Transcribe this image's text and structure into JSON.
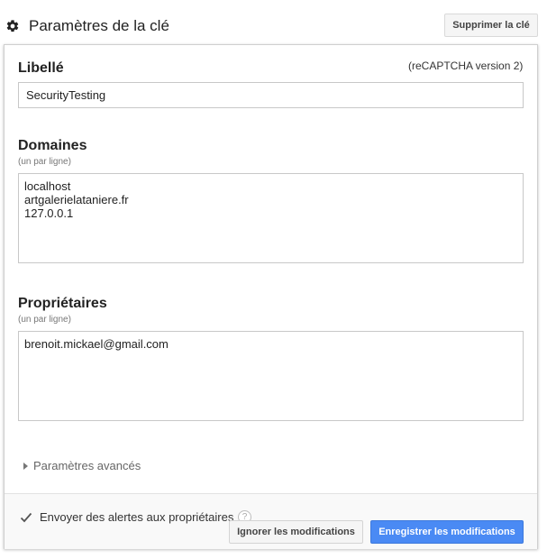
{
  "header": {
    "title": "Paramètres de la clé",
    "icon": "gear-icon",
    "delete_label": "Supprimer la clé"
  },
  "label_section": {
    "heading": "Libellé",
    "version": "(reCAPTCHA version 2)",
    "value": "SecurityTesting"
  },
  "domains_section": {
    "heading": "Domaines",
    "hint": "(un par ligne)",
    "value": "localhost\nartgalerielataniere.fr\n127.0.0.1"
  },
  "owners_section": {
    "heading": "Propriétaires",
    "hint": "(un par ligne)",
    "value": "brenoit.mickael@gmail.com"
  },
  "advanced": {
    "label": "Paramètres avancés"
  },
  "footer": {
    "alerts_label": "Envoyer des alertes aux propriétaires",
    "alerts_checked": true,
    "help_glyph": "?",
    "ignore_label": "Ignorer les modifications",
    "save_label": "Enregistrer les modifications"
  },
  "colors": {
    "primary": "#4a8af4",
    "secondary_button": "#f5f5f5"
  }
}
